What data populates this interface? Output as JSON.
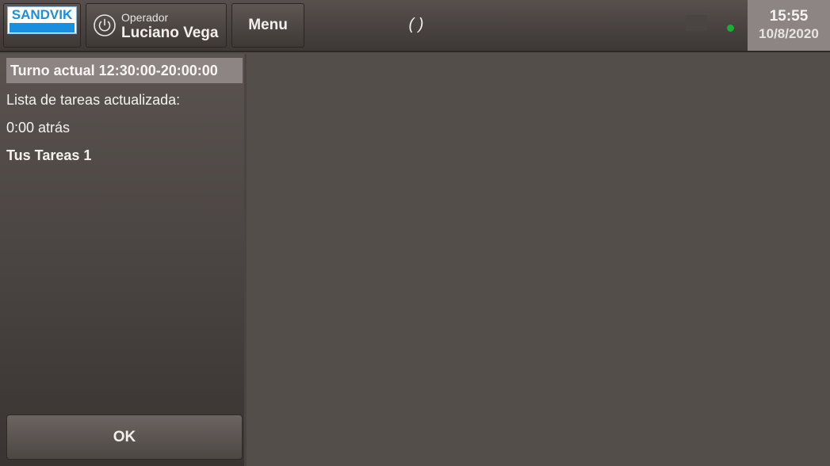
{
  "header": {
    "logo_text": "SANDVIK",
    "operator_label": "Operador",
    "operator_name": "Luciano Vega",
    "menu_label": "Menu",
    "center_status": "( )",
    "connection_status_color": "#17b130",
    "clock_time": "15:55",
    "clock_date": "10/8/2020"
  },
  "sidepanel": {
    "shift_title": "Turno actual 12:30:00-20:00:00",
    "task_list_updated": "Lista de tareas actualizada:",
    "time_ago": "0:00 atrás",
    "your_tasks": "Tus Tareas 1",
    "ok_label": "OK"
  },
  "colors": {
    "background": "#544e4b",
    "brand_blue": "#1a8fe0",
    "panel_header": "#8c8583"
  },
  "icons": {
    "power": "power-icon",
    "logo": "sandvik-logo"
  }
}
